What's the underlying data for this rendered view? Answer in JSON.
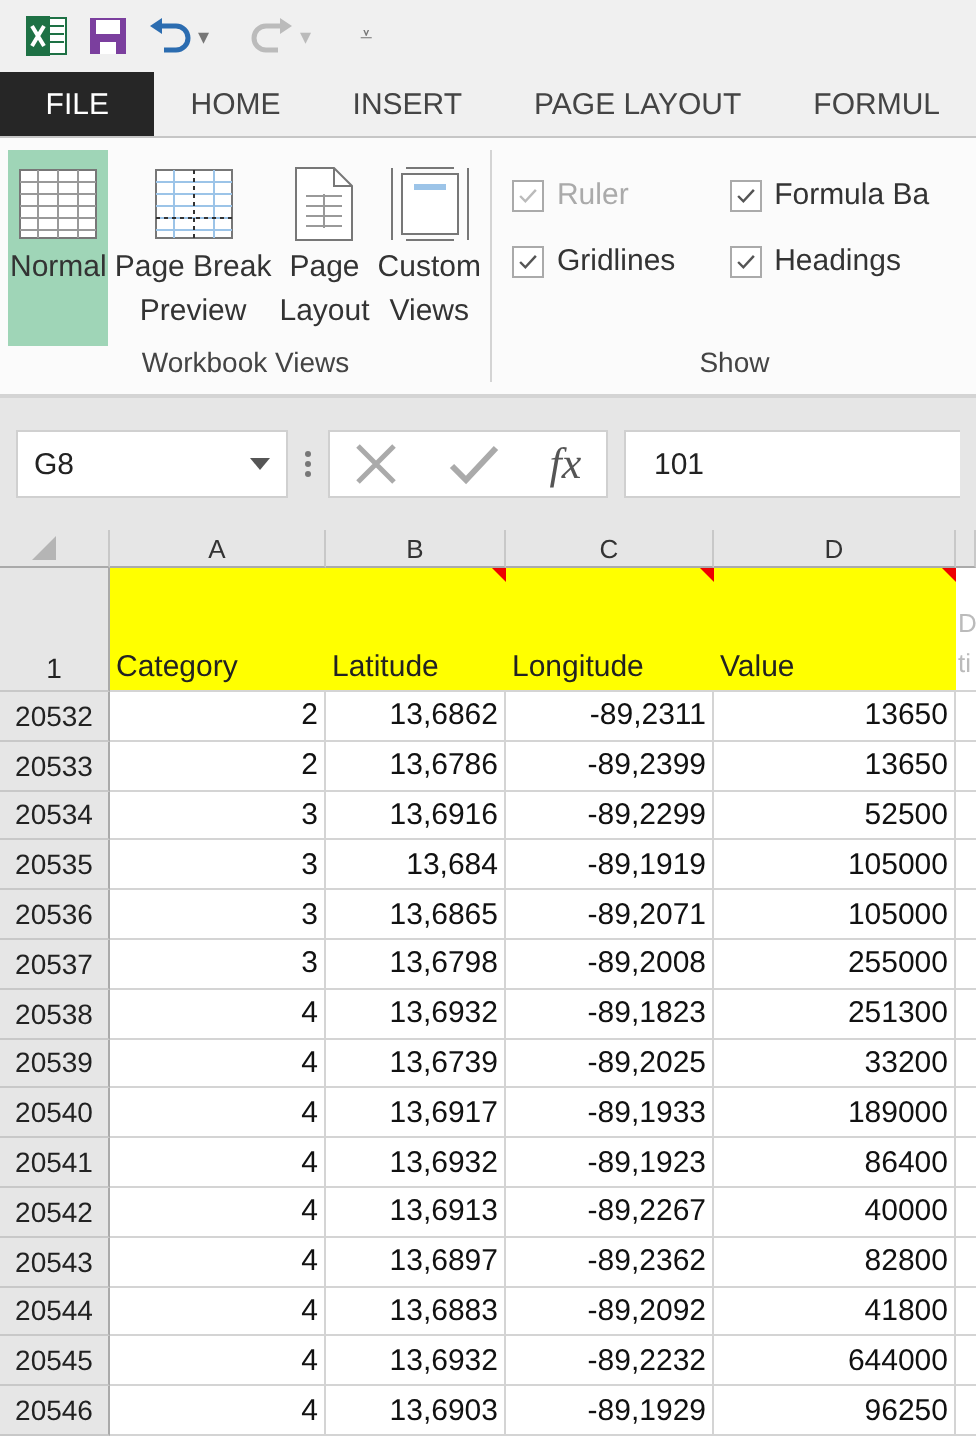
{
  "quick_access": {
    "undo_dropdown": "▾",
    "redo_dropdown": "▾",
    "customize": "⩡"
  },
  "tabs": [
    {
      "label": "FILE",
      "kind": "file",
      "selected": false
    },
    {
      "label": "HOME",
      "kind": "tab",
      "selected": false
    },
    {
      "label": "INSERT",
      "kind": "tab",
      "selected": false
    },
    {
      "label": "PAGE LAYOUT",
      "kind": "tab",
      "selected": false
    },
    {
      "label": "FORMUL",
      "kind": "tab",
      "selected": false
    }
  ],
  "ribbon": {
    "groups": [
      {
        "title": "Workbook Views",
        "kind": "buttons",
        "items": [
          {
            "label": "Normal",
            "selected": true
          },
          {
            "label": "Page Break Preview",
            "selected": false
          },
          {
            "label": "Page Layout",
            "selected": false
          },
          {
            "label": "Custom Views",
            "selected": false
          }
        ]
      },
      {
        "title": "Show",
        "kind": "checks",
        "items": [
          {
            "label": "Ruler",
            "checked": true,
            "disabled": true
          },
          {
            "label": "Formula Ba",
            "checked": true,
            "disabled": false
          },
          {
            "label": "Gridlines",
            "checked": true,
            "disabled": false
          },
          {
            "label": "Headings",
            "checked": true,
            "disabled": false
          }
        ]
      }
    ]
  },
  "formula_bar": {
    "name_box": "G8",
    "function_label": "fx",
    "value": "101"
  },
  "sheet": {
    "columns": [
      "A",
      "B",
      "C",
      "D"
    ],
    "header_row": {
      "number": "1",
      "cells": [
        {
          "text": "Category",
          "comment": false
        },
        {
          "text": "Latitude",
          "comment": true
        },
        {
          "text": "Longitude",
          "comment": true
        },
        {
          "text": "Value",
          "comment": true
        }
      ],
      "column_5": [
        "D",
        "ti"
      ]
    },
    "rows": [
      {
        "number": "20532",
        "cells": [
          "2",
          "13,6862",
          "-89,2311",
          "13650"
        ]
      },
      {
        "number": "20533",
        "cells": [
          "2",
          "13,6786",
          "-89,2399",
          "13650"
        ]
      },
      {
        "number": "20534",
        "cells": [
          "3",
          "13,6916",
          "-89,2299",
          "52500"
        ]
      },
      {
        "number": "20535",
        "cells": [
          "3",
          "13,684",
          "-89,1919",
          "105000"
        ]
      },
      {
        "number": "20536",
        "cells": [
          "3",
          "13,6865",
          "-89,2071",
          "105000"
        ]
      },
      {
        "number": "20537",
        "cells": [
          "3",
          "13,6798",
          "-89,2008",
          "255000"
        ]
      },
      {
        "number": "20538",
        "cells": [
          "4",
          "13,6932",
          "-89,1823",
          "251300"
        ]
      },
      {
        "number": "20539",
        "cells": [
          "4",
          "13,6739",
          "-89,2025",
          "33200"
        ]
      },
      {
        "number": "20540",
        "cells": [
          "4",
          "13,6917",
          "-89,1933",
          "189000"
        ]
      },
      {
        "number": "20541",
        "cells": [
          "4",
          "13,6932",
          "-89,1923",
          "86400"
        ]
      },
      {
        "number": "20542",
        "cells": [
          "4",
          "13,6913",
          "-89,2267",
          "40000"
        ]
      },
      {
        "number": "20543",
        "cells": [
          "4",
          "13,6897",
          "-89,2362",
          "82800"
        ]
      },
      {
        "number": "20544",
        "cells": [
          "4",
          "13,6883",
          "-89,2092",
          "41800"
        ]
      },
      {
        "number": "20545",
        "cells": [
          "4",
          "13,6932",
          "-89,2232",
          "644000"
        ]
      },
      {
        "number": "20546",
        "cells": [
          "4",
          "13,6903",
          "-89,1929",
          "96250"
        ]
      }
    ]
  }
}
